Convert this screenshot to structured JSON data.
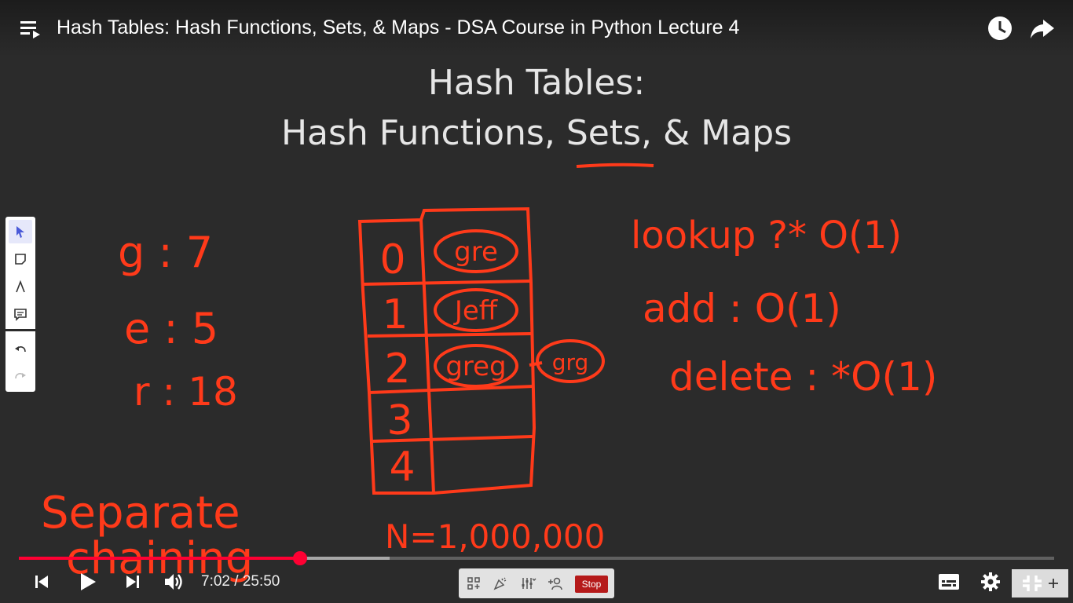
{
  "video": {
    "title": "Hash Tables: Hash Functions, Sets, & Maps - DSA Course in Python Lecture 4"
  },
  "slide": {
    "title_line1": "Hash Tables:",
    "title_line2": "Hash Functions, Sets, & Maps"
  },
  "whiteboard": {
    "letter_hashes": [
      {
        "letter": "g",
        "value": "7"
      },
      {
        "letter": "e",
        "value": "5"
      },
      {
        "letter": "r",
        "value": "18"
      }
    ],
    "table_indices": [
      "0",
      "1",
      "2",
      "3",
      "4"
    ],
    "table_entries": [
      "gre",
      "Jeff",
      "greg",
      ""
    ],
    "chained_entry": "grg",
    "size_note": "N=1,000,000",
    "technique_note": "Separate chaining",
    "ops": {
      "lookup": "lookup ?* O(1)",
      "add": "add : O(1)",
      "delete": "delete : *O(1)"
    }
  },
  "player": {
    "current_time": "7:02",
    "duration": "25:50",
    "time_display": "7:02 / 25:50",
    "progress_fraction": 0.2717,
    "buffered_fraction": 0.3583,
    "accent": "#ff0033"
  },
  "recorder": {
    "stop_label": "Stop"
  },
  "icons": {
    "playlist": "playlist-icon",
    "watch_later": "clock-icon",
    "share": "share-icon"
  }
}
